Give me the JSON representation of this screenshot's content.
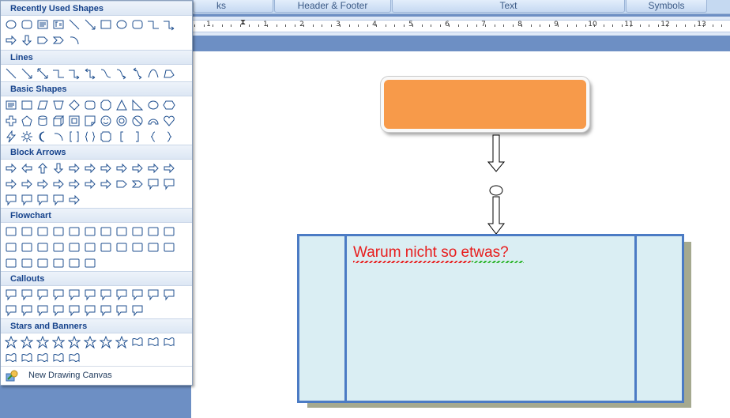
{
  "ribbon": {
    "groups": [
      {
        "label": "ks"
      },
      {
        "label": "Header & Footer"
      },
      {
        "label": "Text"
      },
      {
        "label": "Symbols"
      }
    ]
  },
  "ruler": {
    "numbers": [
      "1",
      "1",
      "2",
      "3",
      "4",
      "5",
      "6",
      "7",
      "8",
      "9",
      "10",
      "11",
      "12",
      "13"
    ]
  },
  "gallery": {
    "sections": [
      {
        "title": "Recently Used Shapes",
        "icons": [
          "oval",
          "rounded-rectangle",
          "text-box",
          "text-box-2",
          "line",
          "arrow-line",
          "rectangle",
          "oval",
          "rounded-rectangle",
          "elbow-connector",
          "elbow-arrow",
          "right-arrow",
          "down-arrow",
          "pentagon-arrow",
          "chevron",
          "arc"
        ]
      },
      {
        "title": "Lines",
        "icons": [
          "line",
          "arrow-line",
          "double-arrow-line",
          "elbow-connector",
          "elbow-arrow",
          "elbow-double-arrow",
          "curved-connector",
          "curved-arrow",
          "curved-double-arrow",
          "curve",
          "freeform",
          "scribble"
        ]
      },
      {
        "title": "Basic Shapes",
        "icons": [
          "text-box",
          "rectangle",
          "parallelogram",
          "trapezoid",
          "diamond",
          "rounded-rectangle",
          "octagon",
          "triangle",
          "right-triangle",
          "oval",
          "hexagon",
          "cross",
          "pentagon",
          "can",
          "cube",
          "bevel",
          "folded-corner",
          "smiley",
          "donut",
          "no-symbol",
          "block-arc",
          "heart",
          "lightning",
          "sun",
          "moon",
          "arc",
          "bracket-pair",
          "brace-pair",
          "plaque",
          "left-bracket",
          "right-bracket",
          "left-brace",
          "right-brace"
        ]
      },
      {
        "title": "Block Arrows",
        "icons": [
          "right-arrow",
          "left-arrow",
          "up-arrow",
          "down-arrow",
          "left-right-arrow",
          "up-down-arrow",
          "quad-arrow",
          "left-right-up-arrow",
          "bent-arrow",
          "u-turn-arrow",
          "left-up-arrow",
          "bent-up-arrow",
          "curved-right-arrow",
          "curved-left-arrow",
          "curved-up-arrow",
          "curved-down-arrow",
          "striped-right-arrow",
          "notched-right-arrow",
          "pentagon-arrow",
          "chevron",
          "right-arrow-callout",
          "left-arrow-callout",
          "up-arrow-callout",
          "down-arrow-callout",
          "left-right-arrow-callout",
          "quad-arrow-callout",
          "circular-arrow"
        ]
      },
      {
        "title": "Flowchart",
        "icons": [
          "process",
          "alternate-process",
          "decision",
          "data",
          "predefined-process",
          "internal-storage",
          "document",
          "multidocument",
          "terminator",
          "preparation",
          "manual-input",
          "manual-operation",
          "connector",
          "off-page-connector",
          "card",
          "punched-tape",
          "summing-junction",
          "or",
          "collate",
          "sort",
          "extract",
          "merge",
          "stored-data",
          "delay",
          "sequential-access",
          "magnetic-disk",
          "direct-access",
          "display"
        ]
      },
      {
        "title": "Callouts",
        "icons": [
          "rectangular-callout",
          "rounded-callout",
          "oval-callout",
          "cloud-callout",
          "line-callout-1",
          "line-callout-2",
          "line-callout-3",
          "line-callout-4",
          "line-callout-accent-1",
          "line-callout-accent-2",
          "line-callout-accent-3",
          "line-callout-accent-4",
          "line-callout-border-1",
          "line-callout-border-2",
          "line-callout-border-3",
          "line-callout-border-4",
          "line-callout-accent-border-1",
          "line-callout-accent-border-2",
          "line-callout-accent-border-3",
          "line-callout-accent-border-4"
        ]
      },
      {
        "title": "Stars and Banners",
        "icons": [
          "explosion-1",
          "explosion-2",
          "4-point-star",
          "5-point-star",
          "8-point-star",
          "16-point-star",
          "24-point-star",
          "32-point-star",
          "up-ribbon",
          "down-ribbon",
          "curved-up-ribbon",
          "curved-down-ribbon",
          "vertical-scroll",
          "horizontal-scroll",
          "wave",
          "double-wave"
        ]
      }
    ],
    "new_canvas_label": "New Drawing Canvas"
  },
  "document": {
    "callout_text": "Warum nicht so etwas?"
  },
  "colors": {
    "orange_shape": "#f79a4a",
    "box_fill": "#daeef3",
    "box_border": "#4b7bc4",
    "text_red": "#e81c1c"
  }
}
